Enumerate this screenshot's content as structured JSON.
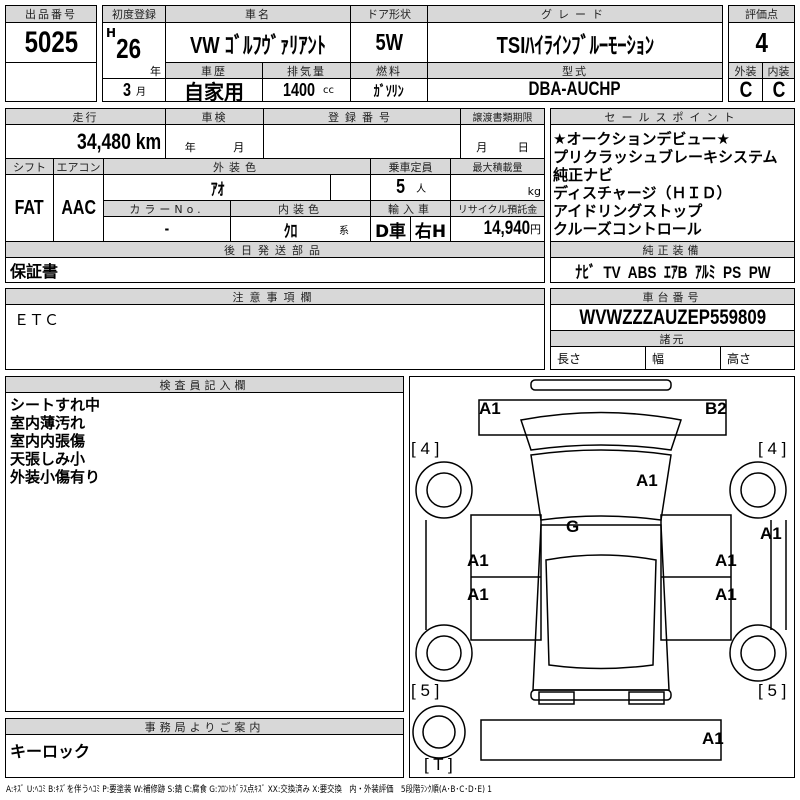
{
  "lot": {
    "label": "出品番号",
    "value": "5025"
  },
  "car": {
    "first_reg_label": "初度登録",
    "era": "H",
    "year": "26",
    "year_unit": "年",
    "month": "3",
    "month_unit": "月",
    "name_label": "車名",
    "name": "VW ｺﾞﾙﾌｳﾞｧﾘｱﾝﾄ",
    "door_label": "ドア形状",
    "door": "5W",
    "grade_label": "グレード",
    "grade": "TSIﾊｲﾗｲﾝﾌﾞﾙｰﾓｰｼｮﾝ",
    "history_label": "車歴",
    "history": "自家用",
    "displacement_label": "排気量",
    "displacement": "1400",
    "displacement_unit": "cc",
    "fuel_label": "燃料",
    "fuel": "ｶﾞｿﾘﾝ",
    "model_label": "型式",
    "model": "DBA-AUCHP"
  },
  "score": {
    "label": "評価点",
    "value": "4",
    "ext_label": "外装",
    "int_label": "内装",
    "ext": "C",
    "int": "C"
  },
  "details": {
    "mileage_label": "走行",
    "mileage": "34,480 km",
    "inspection_label": "車検",
    "insp_year": "年",
    "insp_month": "月",
    "reg_no_label": "登録番号",
    "transfer_label": "譲渡書類期限",
    "transfer_month": "月",
    "transfer_day": "日",
    "shift_label": "シフト",
    "shift": "FAT",
    "ac_label": "エアコン",
    "ac": "AAC",
    "color_label": "外装色",
    "color": "ｱｵ",
    "capacity_label": "乗車定員",
    "capacity": "5",
    "capacity_unit": "人",
    "load_label": "最大積載量",
    "load_unit": "kg",
    "color_no_label": "カラーNo.",
    "color_no": "-",
    "interior_label": "内装色",
    "interior": "ｸﾛ",
    "interior_unit": "系",
    "import_label": "輸入車",
    "import_type": "D車",
    "steering": "右H",
    "recycle_label": "リサイクル預託金",
    "recycle": "14,940",
    "recycle_unit": "円",
    "parts_label": "後日発送部品",
    "parts": "保証書"
  },
  "sales": {
    "label": "セールスポイント",
    "items": [
      "★オークションデビュー★",
      "プリクラッシュブレーキシステム",
      "純正ナビ",
      "ディスチャージ（ＨＩＤ）",
      "アイドリングストップ",
      "クルーズコントロール"
    ],
    "equip_label": "純正装備",
    "equip": "ﾅﾋﾞ  TV  ABS  ｴｱB  ｱﾙﾐ  PS  PW"
  },
  "notes": {
    "label": "注意事項欄",
    "value": "ＥＴＣ"
  },
  "chassis": {
    "label": "車台番号",
    "value": "WVWZZZAUZEP559809",
    "spec_label": "諸元",
    "length": "長さ",
    "width": "幅",
    "height": "高さ"
  },
  "inspector": {
    "label": "検査員記入欄",
    "items": [
      "シートすれ中",
      "室内薄汚れ",
      "室内内張傷",
      "天張しみ小",
      "外装小傷有り"
    ]
  },
  "office": {
    "label": "事務局よりご案内",
    "value": "キーロック"
  },
  "diagram": {
    "marks": [
      "A1",
      "B2",
      "[ 4 ]",
      "[ 4 ]",
      "A1",
      "G",
      "A1",
      "A1",
      "A1",
      "A1",
      "A1",
      "[ 5 ]",
      "[ 5 ]",
      "A1",
      "[ T ]"
    ]
  },
  "legend": "A:ｷｽﾞ U:ﾍｺﾐ B:ｷｽﾞを伴うﾍｺﾐ P:要塗装 W:補修跡 S:錆 C:腐食 G:ﾌﾛﾝﾄｶﾞﾗｽ点ｷｽﾞ XX:交換済み X:要交換　内・外装評価　5段階ﾗﾝｸ順(A･B･C･D･E) 1"
}
